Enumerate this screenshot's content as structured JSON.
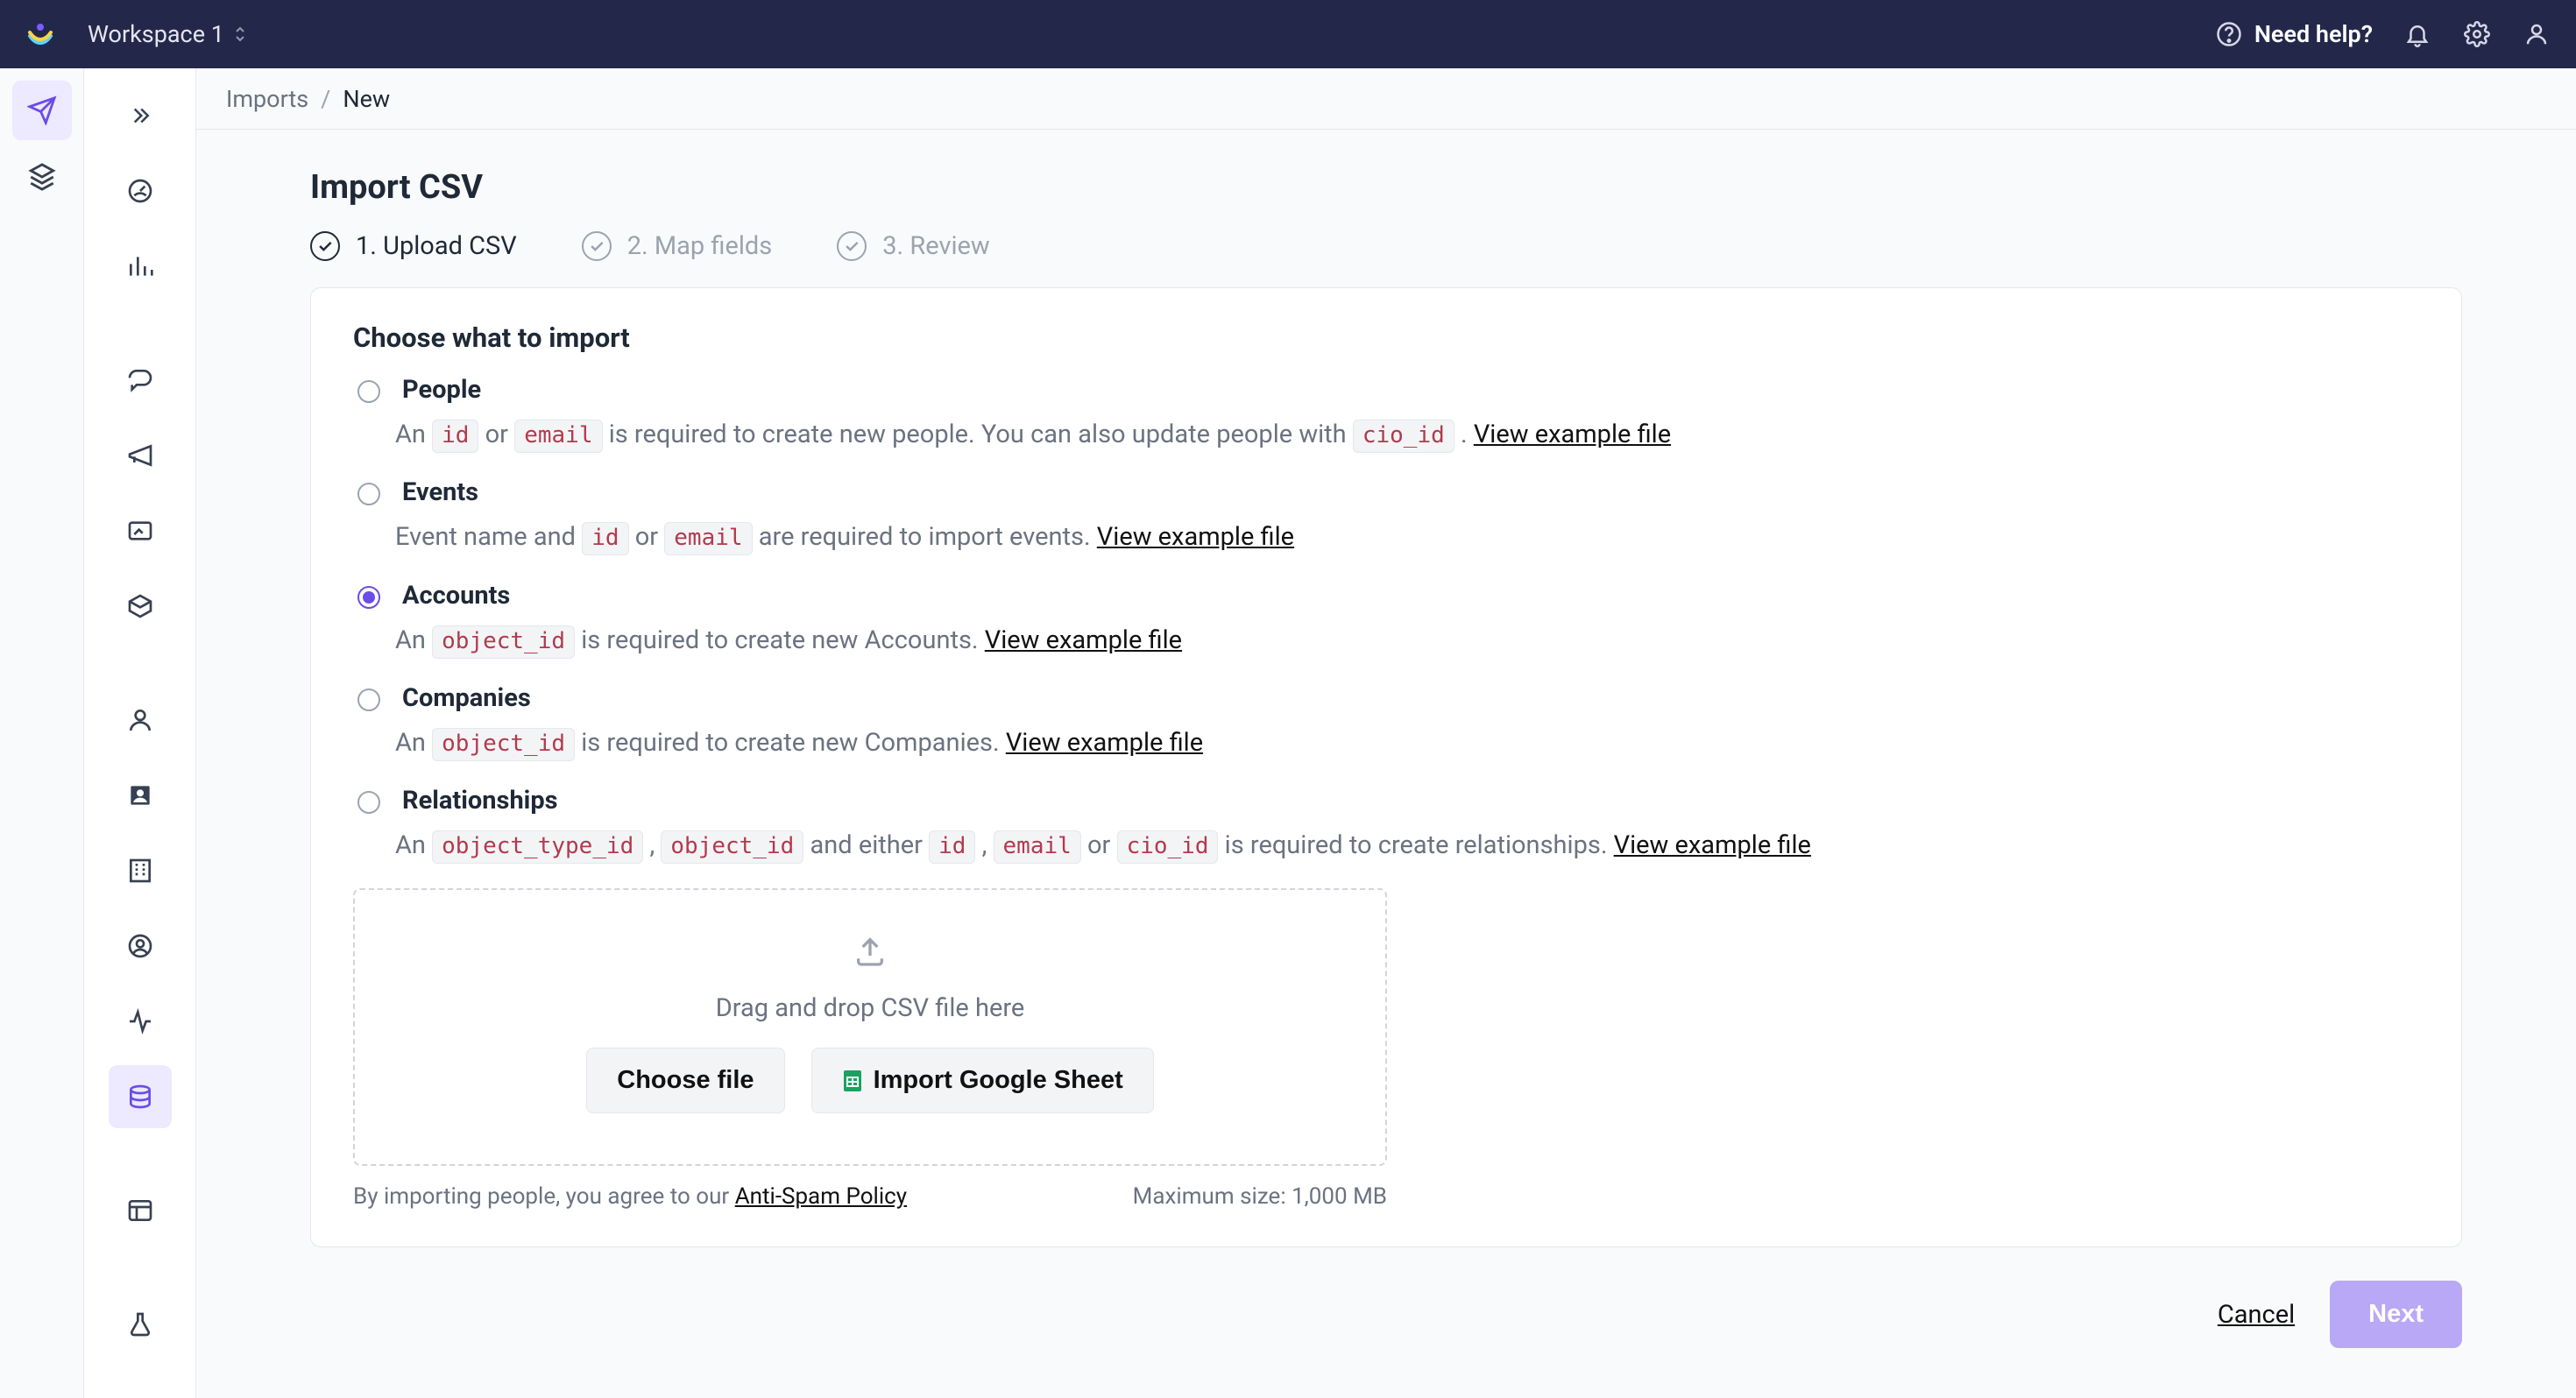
{
  "workspace_label": "Workspace 1",
  "topnav": {
    "help": "Need help?"
  },
  "breadcrumb": {
    "root": "Imports",
    "sep": "/",
    "current": "New"
  },
  "page_title": "Import CSV",
  "steps": [
    {
      "label": "1. Upload CSV"
    },
    {
      "label": "2. Map fields"
    },
    {
      "label": "3. Review"
    }
  ],
  "section_title": "Choose what to import",
  "options": {
    "people": {
      "label": "People",
      "desc_pre": "An ",
      "code1": "id",
      "desc_mid1": " or ",
      "code2": "email",
      "desc_mid2": " is required to create new people. You can also update people with ",
      "code3": "cio_id",
      "desc_post": " . ",
      "link": "View example file"
    },
    "events": {
      "label": "Events",
      "desc_pre": "Event name and ",
      "code1": "id",
      "desc_mid1": " or ",
      "code2": "email",
      "desc_post": " are required to import events. ",
      "link": "View example file"
    },
    "accounts": {
      "label": "Accounts",
      "desc_pre": "An ",
      "code1": "object_id",
      "desc_post": " is required to create new Accounts. ",
      "link": "View example file"
    },
    "companies": {
      "label": "Companies",
      "desc_pre": "An ",
      "code1": "object_id",
      "desc_post": " is required to create new Companies. ",
      "link": "View example file"
    },
    "relationships": {
      "label": "Relationships",
      "desc_pre": "An ",
      "code1": "object_type_id",
      "desc_mid1": " , ",
      "code2": "object_id",
      "desc_mid2": " and either ",
      "code3": "id",
      "desc_mid3": " , ",
      "code4": "email",
      "desc_mid4": " or ",
      "code5": "cio_id",
      "desc_post": " is required to create relationships. ",
      "link": "View example file"
    }
  },
  "dropzone": {
    "text": "Drag and drop CSV file here",
    "choose_label": "Choose file",
    "gsheet_label": "Import Google Sheet"
  },
  "notes": {
    "policy_pre": "By importing people, you agree to our ",
    "policy_link": "Anti-Spam Policy",
    "max": "Maximum size: 1,000 MB"
  },
  "footer": {
    "cancel": "Cancel",
    "next": "Next"
  }
}
